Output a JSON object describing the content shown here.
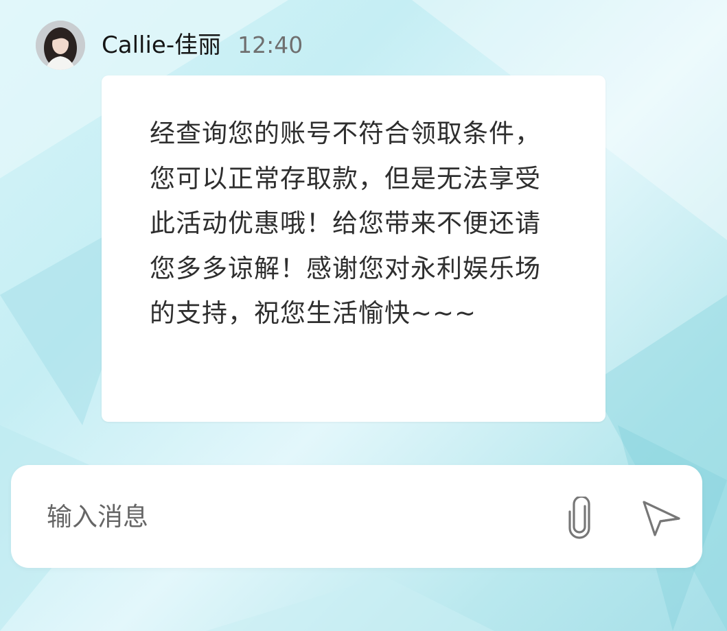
{
  "theme": {
    "accent": "#a6dfe8",
    "bubble_background": "#ffffff",
    "text_color": "#2e2e2e"
  },
  "header": {
    "avatar_icon": "user-avatar-photo",
    "sender_name": "Callie-佳丽",
    "time": "12:40"
  },
  "message": {
    "text": "经查询您的账号不符合领取条件，您可以正常存取款，但是无法享受此活动优惠哦！给您带来不便还请您多多谅解！感谢您对永利娱乐场的支持，祝您生活愉快~~~"
  },
  "composer": {
    "placeholder": "输入消息",
    "value": "",
    "attach_icon": "paperclip-icon",
    "send_icon": "send-icon"
  }
}
